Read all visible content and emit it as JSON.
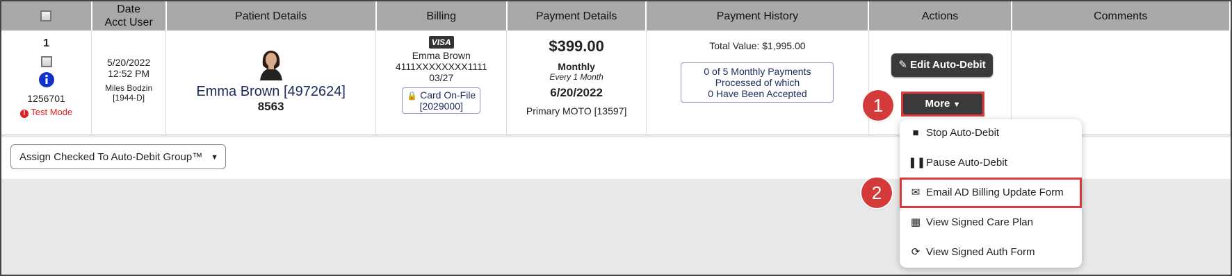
{
  "headers": [
    "Date\nAcct User",
    "Patient Details",
    "Billing",
    "Payment Details",
    "Payment History",
    "Actions",
    "Comments"
  ],
  "row": {
    "index": "1",
    "account_number": "1256701",
    "test_mode": "Test Mode",
    "date": "5/20/2022",
    "time": "12:52 PM",
    "acct_user": "Miles Bodzin",
    "acct_user_id": "[1944-D]",
    "patient_name": "Emma Brown [4972624]",
    "patient_code": "8563",
    "card_brand": "VISA",
    "billing_name": "Emma Brown",
    "card_number": "4111XXXXXXXX1111",
    "card_exp": "03/27",
    "card_on_file": "Card On-File",
    "card_on_file_id": "[2029000]",
    "amount": "$399.00",
    "frequency": "Monthly",
    "frequency_detail": "Every 1 Month",
    "next_date": "6/20/2022",
    "processor": "Primary MOTO [13597]",
    "total_value": "Total Value: $1,995.00",
    "history_line1": "0 of 5 Monthly Payments",
    "history_line2": "Processed of which",
    "history_line3": "0 Have Been Accepted",
    "edit_button": "Edit Auto-Debit",
    "more_button": "More"
  },
  "group_select": "Assign Checked To Auto-Debit Group™",
  "menu": {
    "items": [
      {
        "label": "Stop Auto-Debit",
        "icon": "stop-icon"
      },
      {
        "label": "Pause Auto-Debit",
        "icon": "pause-icon"
      },
      {
        "label": "Email AD Billing Update Form",
        "icon": "envelope-icon"
      },
      {
        "label": "View Signed Care Plan",
        "icon": "calculator-icon"
      },
      {
        "label": "View Signed Auth Form",
        "icon": "refresh-icon"
      }
    ]
  },
  "annotations": [
    "1",
    "2"
  ],
  "colors": {
    "header_bg": "#a9a9a9",
    "highlight": "#d9393a",
    "link_navy": "#1a2a5a",
    "test_mode": "#e02020",
    "info_blue": "#1133cc"
  }
}
